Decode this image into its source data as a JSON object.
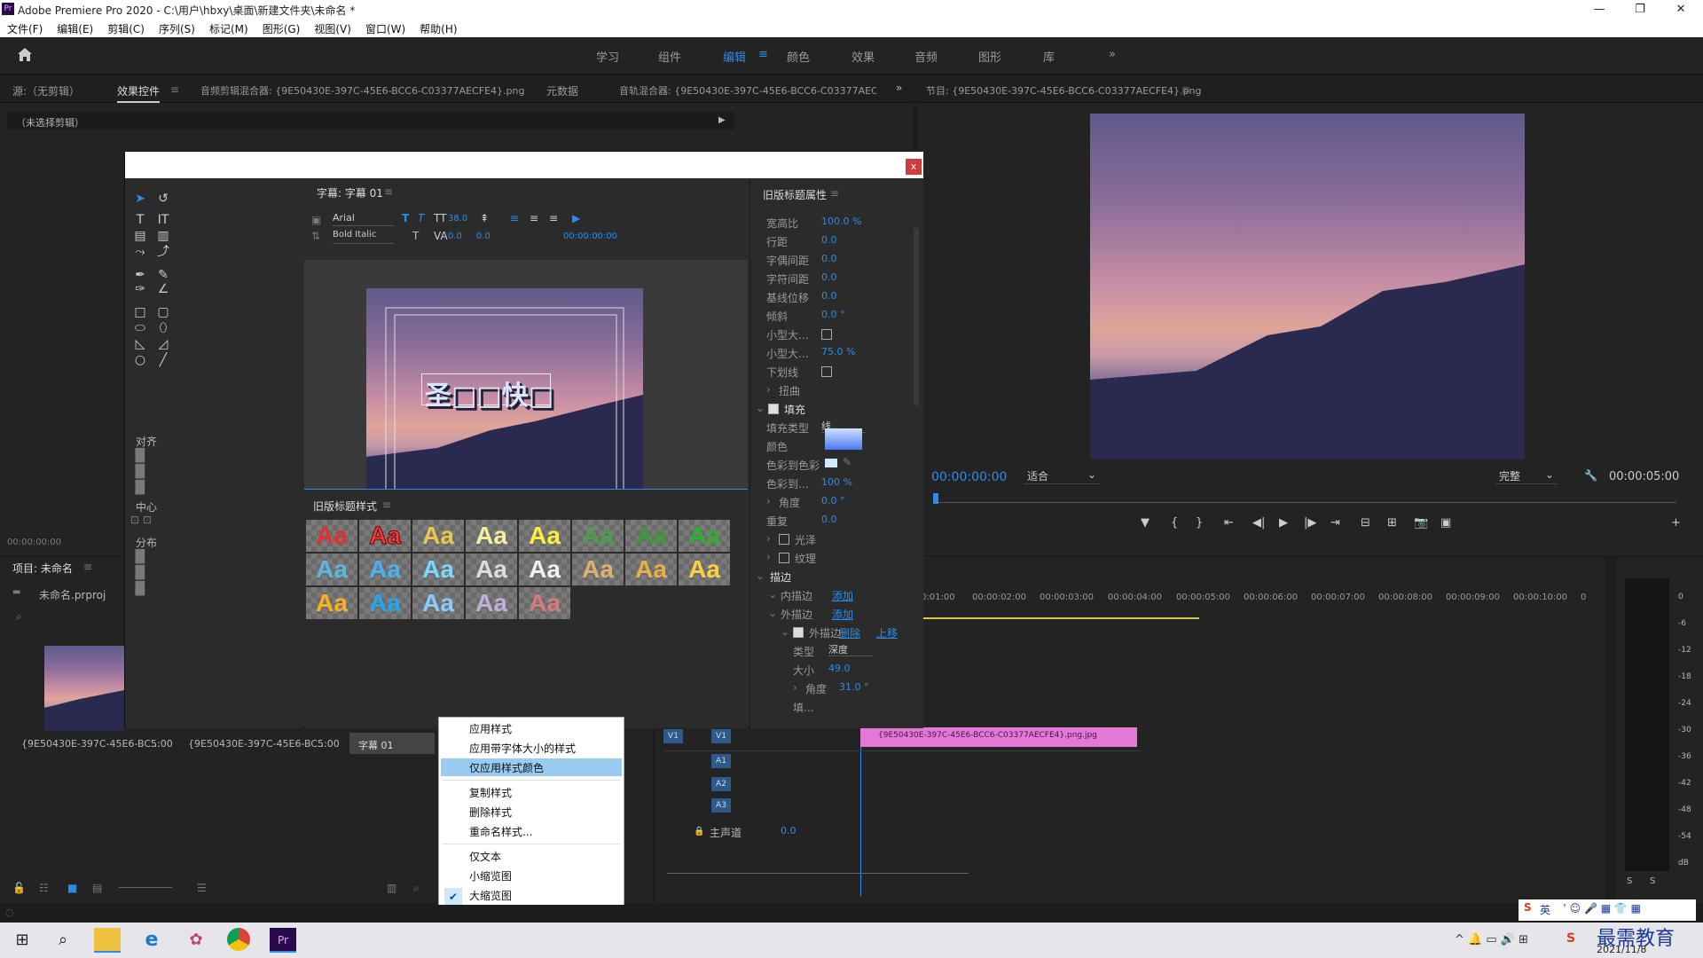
{
  "window": {
    "title": "Adobe Premiere Pro 2020 - C:\\用户\\hbxy\\桌面\\新建文件夹\\未命名 *",
    "controls": [
      "—",
      "❐",
      "✕"
    ]
  },
  "menubar": [
    "文件(F)",
    "编辑(E)",
    "剪辑(C)",
    "序列(S)",
    "标记(M)",
    "图形(G)",
    "视图(V)",
    "窗口(W)",
    "帮助(H)"
  ],
  "workspaces": [
    "学习",
    "组件",
    "编辑",
    "颜色",
    "效果",
    "音频",
    "图形",
    "库"
  ],
  "active_workspace": "编辑",
  "source_panel": {
    "tabs": [
      "源:（无剪辑）",
      "效果控件",
      "音频剪辑混合器: {9E50430E-397C-45E6-BCC6-C03377AECFE4}.png",
      "元数据",
      "音轨混合器: {9E50430E-397C-45E6-BCC6-C03377AECFE"
    ],
    "no_clip": "（未选择剪辑）",
    "timecode": "00:00:00:00"
  },
  "program_panel": {
    "title": "节目: {9E50430E-397C-45E6-BCC6-C03377AECFE4}.png",
    "timecode_left": "00:00:00:00",
    "fit": "适合",
    "quality": "完整",
    "timecode_right": "00:00:05:00"
  },
  "title_dialog": {
    "title_tab": "字幕: 字幕 01",
    "font": "Arial",
    "font_style": "Bold Italic",
    "font_size": "38.0",
    "kerning": "0.0",
    "leading": "0.0",
    "timecode": "00:00:00:00",
    "canvas_text": "圣□□快□",
    "align_label": "对齐",
    "center_label": "中心",
    "distribute_label": "分布",
    "styles_tab": "旧版标题样式",
    "props_tab": "旧版标题属性"
  },
  "properties": [
    {
      "label": "宽高比",
      "value": "100.0 %"
    },
    {
      "label": "行距",
      "value": "0.0"
    },
    {
      "label": "字偶间距",
      "value": "0.0"
    },
    {
      "label": "字符间距",
      "value": "0.0"
    },
    {
      "label": "基线位移",
      "value": "0.0"
    },
    {
      "label": "倾斜",
      "value": "0.0 °"
    },
    {
      "label": "小型大...",
      "value": ""
    },
    {
      "label": "小型大...",
      "value": "75.0 %"
    },
    {
      "label": "下划线",
      "value": ""
    }
  ],
  "fill_section": {
    "warp": "扭曲",
    "fill": "填充",
    "fill_type_label": "填充类型",
    "fill_type": "线...",
    "color_label": "颜色",
    "color_to_color": "色彩到色彩",
    "color_to_pct_label": "色彩到...",
    "color_to_pct": "100 %",
    "angle_label": "角度",
    "angle": "0.0 °",
    "repeat_label": "重复",
    "repeat": "0.0",
    "sheen": "光泽",
    "texture": "纹理",
    "stroke": "描边",
    "inner_stroke": "内描边",
    "add": "添加",
    "outer_stroke": "外描边",
    "add2": "添加",
    "outer_stroke_item": "外描边",
    "delete": "删除",
    "up": "上移",
    "type_label": "类型",
    "type": "深度",
    "size_label": "大小",
    "size": "49.0",
    "angle2_label": "角度",
    "angle2": "31.0 °",
    "fill2": "填..."
  },
  "project_panel": {
    "tab": "项目: 未命名",
    "project_file": "未命名.prproj",
    "items": [
      {
        "name": "{9E50430E-397C-45E6-BC...",
        "duration": "5:00"
      },
      {
        "name": "{9E50430E-397C-45E6-BC...",
        "duration": "5:00"
      },
      {
        "name": "字幕 01",
        "duration": ""
      }
    ]
  },
  "context_menu": {
    "items": [
      "应用样式",
      "应用带字体大小的样式",
      "仅应用样式颜色",
      "复制样式",
      "删除样式",
      "重命名样式...",
      "仅文本",
      "小缩览图",
      "大缩览图"
    ],
    "highlighted": "仅应用样式颜色",
    "checked": "大缩览图"
  },
  "timeline": {
    "ruler": [
      "0:01:00",
      "00:00:02:00",
      "00:00:03:00",
      "00:00:04:00",
      "00:00:05:00",
      "00:00:06:00",
      "00:00:07:00",
      "00:00:08:00",
      "00:00:09:00",
      "00:00:10:00",
      "0"
    ],
    "tracks": [
      "V1",
      "A1",
      "A2",
      "A3"
    ],
    "master": "主声道",
    "master_value": "0.0",
    "clip": "{9E50430E-397C-45E6-BCC6-C03377AECFE4}.png.jpg",
    "meter_labels": [
      "0",
      "-6",
      "-12",
      "-18",
      "-24",
      "-30",
      "-36",
      "-42",
      "-48",
      "-54",
      "dB"
    ],
    "solo": [
      "S",
      "S"
    ]
  },
  "tray": {
    "ime": "英",
    "time": "",
    "date": "2021/11/8",
    "watermark": "最需教育"
  }
}
